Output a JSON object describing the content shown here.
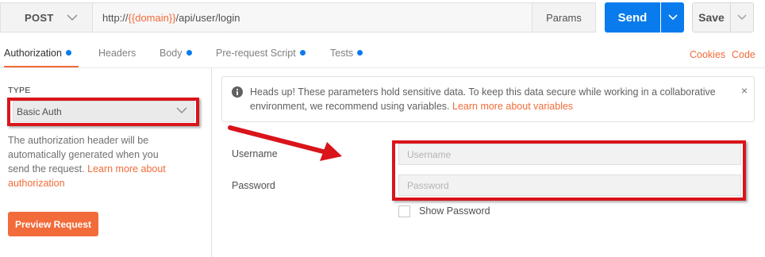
{
  "request": {
    "method": "POST",
    "url_prefix": "http://",
    "url_variable": "{{domain}}",
    "url_suffix": "/api/user/login",
    "params_label": "Params",
    "send_label": "Send",
    "save_label": "Save"
  },
  "tabs": [
    {
      "label": "Authorization",
      "has_dot": true,
      "active": true
    },
    {
      "label": "Headers",
      "has_dot": false,
      "active": false
    },
    {
      "label": "Body",
      "has_dot": true,
      "active": false
    },
    {
      "label": "Pre-request Script",
      "has_dot": true,
      "active": false
    },
    {
      "label": "Tests",
      "has_dot": true,
      "active": false
    }
  ],
  "tab_links": {
    "cookies": "Cookies",
    "code": "Code"
  },
  "auth": {
    "type_label": "TYPE",
    "type_value": "Basic Auth",
    "description_text": "The authorization header will be automatically generated when you send the request.",
    "description_link": "Learn more about authorization",
    "preview_button": "Preview Request"
  },
  "notice": {
    "icon": "info-icon",
    "text": "Heads up! These parameters hold sensitive data. To keep this data secure while working in a collaborative environment, we recommend using variables.",
    "link": "Learn more about variables",
    "close": "×"
  },
  "form": {
    "username_label": "Username",
    "username_placeholder": "Username",
    "password_label": "Password",
    "password_placeholder": "Password",
    "show_password_label": "Show Password",
    "show_password_checked": false
  },
  "colors": {
    "accent_orange": "#f26b3a",
    "send_blue": "#097bed",
    "annotation_red": "#d9141b"
  }
}
